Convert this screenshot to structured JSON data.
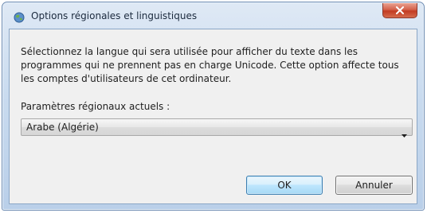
{
  "window": {
    "title": "Options régionales et linguistiques",
    "icon": "globe-icon",
    "close_icon": "close-icon"
  },
  "content": {
    "description": "Sélectionnez la langue qui sera utilisée pour afficher du texte dans les programmes qui ne prennent pas en charge Unicode. Cette option affecte tous les comptes d'utilisateurs de cet ordinateur.",
    "current_label": "Paramètres régionaux actuels :",
    "selected_locale": "Arabe (Algérie)"
  },
  "buttons": {
    "ok": "OK",
    "cancel": "Annuler"
  },
  "colors": {
    "titlebar": "#c9dbef",
    "close_button": "#c23b22",
    "default_button_border": "#3c7fb1"
  }
}
